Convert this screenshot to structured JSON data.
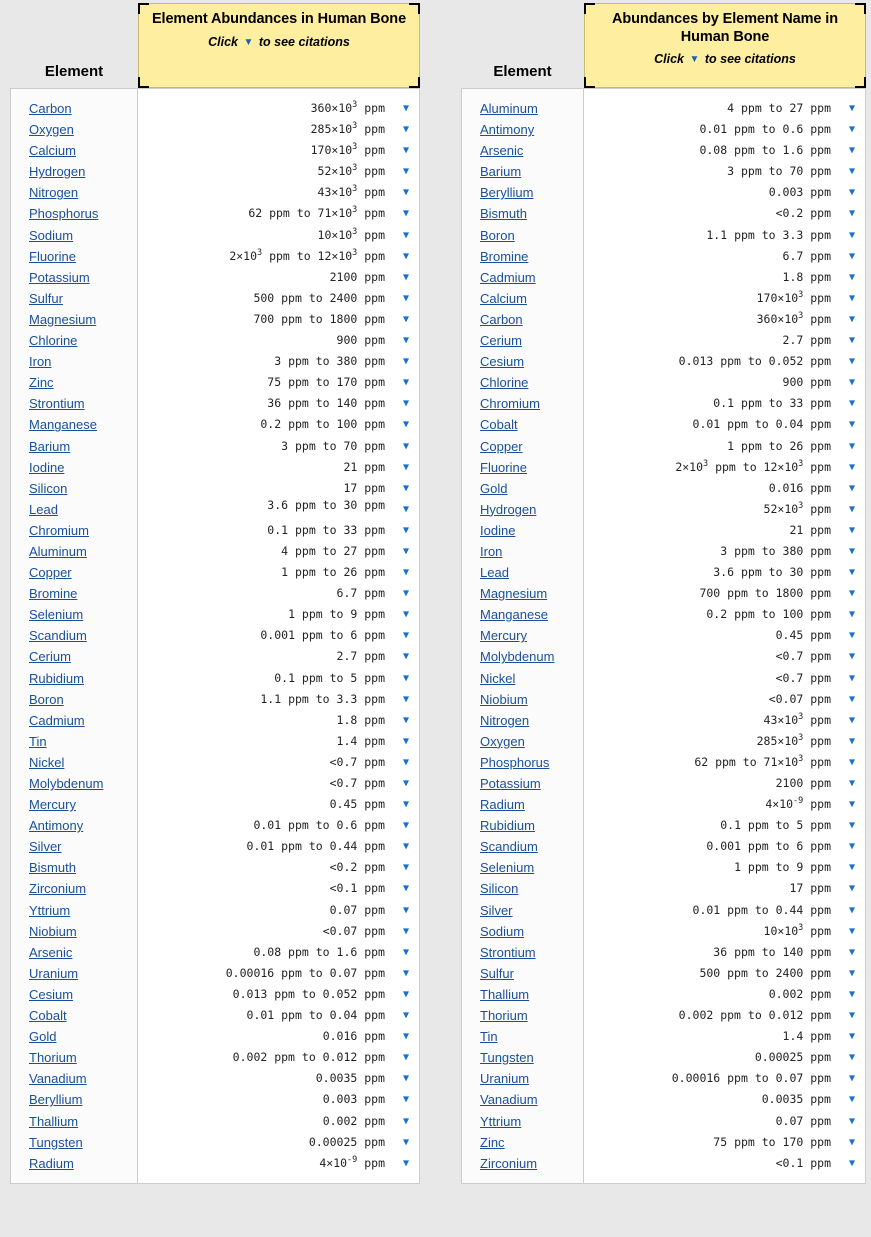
{
  "page": {
    "background": "#e8e8e8",
    "link_color": "#1a4f9c",
    "caret_color": "#1a6fd4",
    "header_background": "#fdeea0"
  },
  "tables": [
    {
      "id": "by-abundance",
      "element_column_header": "Element",
      "title": "Element Abundances in Human Bone",
      "subtitle_prefix": "Click",
      "subtitle_caret": "▼",
      "subtitle_suffix": "to see citations",
      "rows": [
        {
          "element": "Carbon",
          "value": "360×10^3 ppm",
          "value_html": "360×10<sup>3</sup> ppm"
        },
        {
          "element": "Oxygen",
          "value": "285×10^3 ppm",
          "value_html": "285×10<sup>3</sup> ppm"
        },
        {
          "element": "Calcium",
          "value": "170×10^3 ppm",
          "value_html": "170×10<sup>3</sup> ppm"
        },
        {
          "element": "Hydrogen",
          "value": "52×10^3 ppm",
          "value_html": "52×10<sup>3</sup> ppm"
        },
        {
          "element": "Nitrogen",
          "value": "43×10^3 ppm",
          "value_html": "43×10<sup>3</sup> ppm"
        },
        {
          "element": "Phosphorus",
          "value": "62 ppm to 71×10^3 ppm",
          "value_html": "62 ppm to 71×10<sup>3</sup> ppm"
        },
        {
          "element": "Sodium",
          "value": "10×10^3 ppm",
          "value_html": "10×10<sup>3</sup> ppm"
        },
        {
          "element": "Fluorine",
          "value": "2×10^3 ppm to 12×10^3 ppm",
          "value_html": "2×10<sup>3</sup> ppm to 12×10<sup>3</sup> ppm"
        },
        {
          "element": "Potassium",
          "value": "2100 ppm",
          "value_html": "2100 ppm"
        },
        {
          "element": "Sulfur",
          "value": "500 ppm to 2400 ppm",
          "value_html": "500 ppm to 2400 ppm"
        },
        {
          "element": "Magnesium",
          "value": "700 ppm to 1800 ppm",
          "value_html": "700 ppm to 1800 ppm"
        },
        {
          "element": "Chlorine",
          "value": "900 ppm",
          "value_html": "900 ppm"
        },
        {
          "element": "Iron",
          "value": "3 ppm to 380 ppm",
          "value_html": "3 ppm to 380 ppm"
        },
        {
          "element": "Zinc",
          "value": "75 ppm to 170 ppm",
          "value_html": "75 ppm to 170 ppm"
        },
        {
          "element": "Strontium",
          "value": "36 ppm to 140 ppm",
          "value_html": "36 ppm to 140 ppm"
        },
        {
          "element": "Manganese",
          "value": "0.2 ppm to 100 ppm",
          "value_html": "0.2 ppm to 100 ppm"
        },
        {
          "element": "Barium",
          "value": "3 ppm to 70 ppm",
          "value_html": "3 ppm to 70 ppm"
        },
        {
          "element": "Iodine",
          "value": "21 ppm",
          "value_html": "21 ppm"
        },
        {
          "element": "Silicon",
          "value": "17 ppm",
          "value_html": "17 ppm"
        },
        {
          "element": "Lead",
          "value": "3.6 ppm to 30 ppm",
          "value_html": "3.6 ppm to 30 ppm",
          "clipped": true
        },
        {
          "element": "Chromium",
          "value": "0.1 ppm to 33 ppm",
          "value_html": "0.1 ppm to 33 ppm"
        },
        {
          "element": "Aluminum",
          "value": "4 ppm to 27 ppm",
          "value_html": "4 ppm to 27 ppm"
        },
        {
          "element": "Copper",
          "value": "1 ppm to 26 ppm",
          "value_html": "1 ppm to 26 ppm"
        },
        {
          "element": "Bromine",
          "value": "6.7 ppm",
          "value_html": "6.7 ppm"
        },
        {
          "element": "Selenium",
          "value": "1 ppm to 9 ppm",
          "value_html": "1 ppm to 9 ppm"
        },
        {
          "element": "Scandium",
          "value": "0.001 ppm to 6 ppm",
          "value_html": "0.001 ppm to 6 ppm"
        },
        {
          "element": "Cerium",
          "value": "2.7 ppm",
          "value_html": "2.7 ppm"
        },
        {
          "element": "Rubidium",
          "value": "0.1 ppm to 5 ppm",
          "value_html": "0.1 ppm to 5 ppm"
        },
        {
          "element": "Boron",
          "value": "1.1 ppm to 3.3 ppm",
          "value_html": "1.1 ppm to 3.3 ppm"
        },
        {
          "element": "Cadmium",
          "value": "1.8 ppm",
          "value_html": "1.8 ppm"
        },
        {
          "element": "Tin",
          "value": "1.4 ppm",
          "value_html": "1.4 ppm"
        },
        {
          "element": "Nickel",
          "value": "<0.7 ppm",
          "value_html": "&lt;0.7 ppm"
        },
        {
          "element": "Molybdenum",
          "value": "<0.7 ppm",
          "value_html": "&lt;0.7 ppm"
        },
        {
          "element": "Mercury",
          "value": "0.45 ppm",
          "value_html": "0.45 ppm"
        },
        {
          "element": "Antimony",
          "value": "0.01 ppm to 0.6 ppm",
          "value_html": "0.01 ppm to 0.6 ppm"
        },
        {
          "element": "Silver",
          "value": "0.01 ppm to 0.44 ppm",
          "value_html": "0.01 ppm to 0.44 ppm"
        },
        {
          "element": "Bismuth",
          "value": "<0.2 ppm",
          "value_html": "&lt;0.2 ppm"
        },
        {
          "element": "Zirconium",
          "value": "<0.1 ppm",
          "value_html": "&lt;0.1 ppm"
        },
        {
          "element": "Yttrium",
          "value": "0.07 ppm",
          "value_html": "0.07 ppm"
        },
        {
          "element": "Niobium",
          "value": "<0.07 ppm",
          "value_html": "&lt;0.07 ppm"
        },
        {
          "element": "Arsenic",
          "value": "0.08 ppm to 1.6 ppm",
          "value_html": "0.08 ppm to 1.6 ppm"
        },
        {
          "element": "Uranium",
          "value": "0.00016 ppm to 0.07 ppm",
          "value_html": "0.00016 ppm to 0.07 ppm"
        },
        {
          "element": "Cesium",
          "value": "0.013 ppm to 0.052 ppm",
          "value_html": "0.013 ppm to 0.052 ppm"
        },
        {
          "element": "Cobalt",
          "value": "0.01 ppm to 0.04 ppm",
          "value_html": "0.01 ppm to 0.04 ppm"
        },
        {
          "element": "Gold",
          "value": "0.016 ppm",
          "value_html": "0.016 ppm"
        },
        {
          "element": "Thorium",
          "value": "0.002 ppm to 0.012 ppm",
          "value_html": "0.002 ppm to 0.012 ppm"
        },
        {
          "element": "Vanadium",
          "value": "0.0035 ppm",
          "value_html": "0.0035 ppm"
        },
        {
          "element": "Beryllium",
          "value": "0.003 ppm",
          "value_html": "0.003 ppm"
        },
        {
          "element": "Thallium",
          "value": "0.002 ppm",
          "value_html": "0.002 ppm"
        },
        {
          "element": "Tungsten",
          "value": "0.00025 ppm",
          "value_html": "0.00025 ppm"
        },
        {
          "element": "Radium",
          "value": "4×10^-9 ppm",
          "value_html": "4×10<sup>-9</sup> ppm"
        }
      ]
    },
    {
      "id": "by-name",
      "element_column_header": "Element",
      "title": "Abundances by Element Name in Human Bone",
      "subtitle_prefix": "Click",
      "subtitle_caret": "▼",
      "subtitle_suffix": "to see citations",
      "rows": [
        {
          "element": "Aluminum",
          "value": "4 ppm to 27 ppm",
          "value_html": "4 ppm to 27 ppm"
        },
        {
          "element": "Antimony",
          "value": "0.01 ppm to 0.6 ppm",
          "value_html": "0.01 ppm to 0.6 ppm"
        },
        {
          "element": "Arsenic",
          "value": "0.08 ppm to 1.6 ppm",
          "value_html": "0.08 ppm to 1.6 ppm"
        },
        {
          "element": "Barium",
          "value": "3 ppm to 70 ppm",
          "value_html": "3 ppm to 70 ppm"
        },
        {
          "element": "Beryllium",
          "value": "0.003 ppm",
          "value_html": "0.003 ppm"
        },
        {
          "element": "Bismuth",
          "value": "<0.2 ppm",
          "value_html": "&lt;0.2 ppm"
        },
        {
          "element": "Boron",
          "value": "1.1 ppm to 3.3 ppm",
          "value_html": "1.1 ppm to 3.3 ppm"
        },
        {
          "element": "Bromine",
          "value": "6.7 ppm",
          "value_html": "6.7 ppm"
        },
        {
          "element": "Cadmium",
          "value": "1.8 ppm",
          "value_html": "1.8 ppm"
        },
        {
          "element": "Calcium",
          "value": "170×10^3 ppm",
          "value_html": "170×10<sup>3</sup> ppm"
        },
        {
          "element": "Carbon",
          "value": "360×10^3 ppm",
          "value_html": "360×10<sup>3</sup> ppm"
        },
        {
          "element": "Cerium",
          "value": "2.7 ppm",
          "value_html": "2.7 ppm"
        },
        {
          "element": "Cesium",
          "value": "0.013 ppm to 0.052 ppm",
          "value_html": "0.013 ppm to 0.052 ppm"
        },
        {
          "element": "Chlorine",
          "value": "900 ppm",
          "value_html": "900 ppm"
        },
        {
          "element": "Chromium",
          "value": "0.1 ppm to 33 ppm",
          "value_html": "0.1 ppm to 33 ppm"
        },
        {
          "element": "Cobalt",
          "value": "0.01 ppm to 0.04 ppm",
          "value_html": "0.01 ppm to 0.04 ppm"
        },
        {
          "element": "Copper",
          "value": "1 ppm to 26 ppm",
          "value_html": "1 ppm to 26 ppm"
        },
        {
          "element": "Fluorine",
          "value": "2×10^3 ppm to 12×10^3 ppm",
          "value_html": "2×10<sup>3</sup> ppm to 12×10<sup>3</sup> ppm"
        },
        {
          "element": "Gold",
          "value": "0.016 ppm",
          "value_html": "0.016 ppm"
        },
        {
          "element": "Hydrogen",
          "value": "52×10^3 ppm",
          "value_html": "52×10<sup>3</sup> ppm"
        },
        {
          "element": "Iodine",
          "value": "21 ppm",
          "value_html": "21 ppm"
        },
        {
          "element": "Iron",
          "value": "3 ppm to 380 ppm",
          "value_html": "3 ppm to 380 ppm"
        },
        {
          "element": "Lead",
          "value": "3.6 ppm to 30 ppm",
          "value_html": "3.6 ppm to 30 ppm"
        },
        {
          "element": "Magnesium",
          "value": "700 ppm to 1800 ppm",
          "value_html": "700 ppm to 1800 ppm"
        },
        {
          "element": "Manganese",
          "value": "0.2 ppm to 100 ppm",
          "value_html": "0.2 ppm to 100 ppm"
        },
        {
          "element": "Mercury",
          "value": "0.45 ppm",
          "value_html": "0.45 ppm"
        },
        {
          "element": "Molybdenum",
          "value": "<0.7 ppm",
          "value_html": "&lt;0.7 ppm"
        },
        {
          "element": "Nickel",
          "value": "<0.7 ppm",
          "value_html": "&lt;0.7 ppm"
        },
        {
          "element": "Niobium",
          "value": "<0.07 ppm",
          "value_html": "&lt;0.07 ppm"
        },
        {
          "element": "Nitrogen",
          "value": "43×10^3 ppm",
          "value_html": "43×10<sup>3</sup> ppm"
        },
        {
          "element": "Oxygen",
          "value": "285×10^3 ppm",
          "value_html": "285×10<sup>3</sup> ppm"
        },
        {
          "element": "Phosphorus",
          "value": "62 ppm to 71×10^3 ppm",
          "value_html": "62 ppm to 71×10<sup>3</sup> ppm"
        },
        {
          "element": "Potassium",
          "value": "2100 ppm",
          "value_html": "2100 ppm"
        },
        {
          "element": "Radium",
          "value": "4×10^-9 ppm",
          "value_html": "4×10<sup>-9</sup> ppm"
        },
        {
          "element": "Rubidium",
          "value": "0.1 ppm to 5 ppm",
          "value_html": "0.1 ppm to 5 ppm"
        },
        {
          "element": "Scandium",
          "value": "0.001 ppm to 6 ppm",
          "value_html": "0.001 ppm to 6 ppm"
        },
        {
          "element": "Selenium",
          "value": "1 ppm to 9 ppm",
          "value_html": "1 ppm to 9 ppm"
        },
        {
          "element": "Silicon",
          "value": "17 ppm",
          "value_html": "17 ppm"
        },
        {
          "element": "Silver",
          "value": "0.01 ppm to 0.44 ppm",
          "value_html": "0.01 ppm to 0.44 ppm"
        },
        {
          "element": "Sodium",
          "value": "10×10^3 ppm",
          "value_html": "10×10<sup>3</sup> ppm"
        },
        {
          "element": "Strontium",
          "value": "36 ppm to 140 ppm",
          "value_html": "36 ppm to 140 ppm"
        },
        {
          "element": "Sulfur",
          "value": "500 ppm to 2400 ppm",
          "value_html": "500 ppm to 2400 ppm"
        },
        {
          "element": "Thallium",
          "value": "0.002 ppm",
          "value_html": "0.002 ppm"
        },
        {
          "element": "Thorium",
          "value": "0.002 ppm to 0.012 ppm",
          "value_html": "0.002 ppm to 0.012 ppm"
        },
        {
          "element": "Tin",
          "value": "1.4 ppm",
          "value_html": "1.4 ppm"
        },
        {
          "element": "Tungsten",
          "value": "0.00025 ppm",
          "value_html": "0.00025 ppm"
        },
        {
          "element": "Uranium",
          "value": "0.00016 ppm to 0.07 ppm",
          "value_html": "0.00016 ppm to 0.07 ppm"
        },
        {
          "element": "Vanadium",
          "value": "0.0035 ppm",
          "value_html": "0.0035 ppm"
        },
        {
          "element": "Yttrium",
          "value": "0.07 ppm",
          "value_html": "0.07 ppm"
        },
        {
          "element": "Zinc",
          "value": "75 ppm to 170 ppm",
          "value_html": "75 ppm to 170 ppm"
        },
        {
          "element": "Zirconium",
          "value": "<0.1 ppm",
          "value_html": "&lt;0.1 ppm"
        }
      ]
    }
  ]
}
